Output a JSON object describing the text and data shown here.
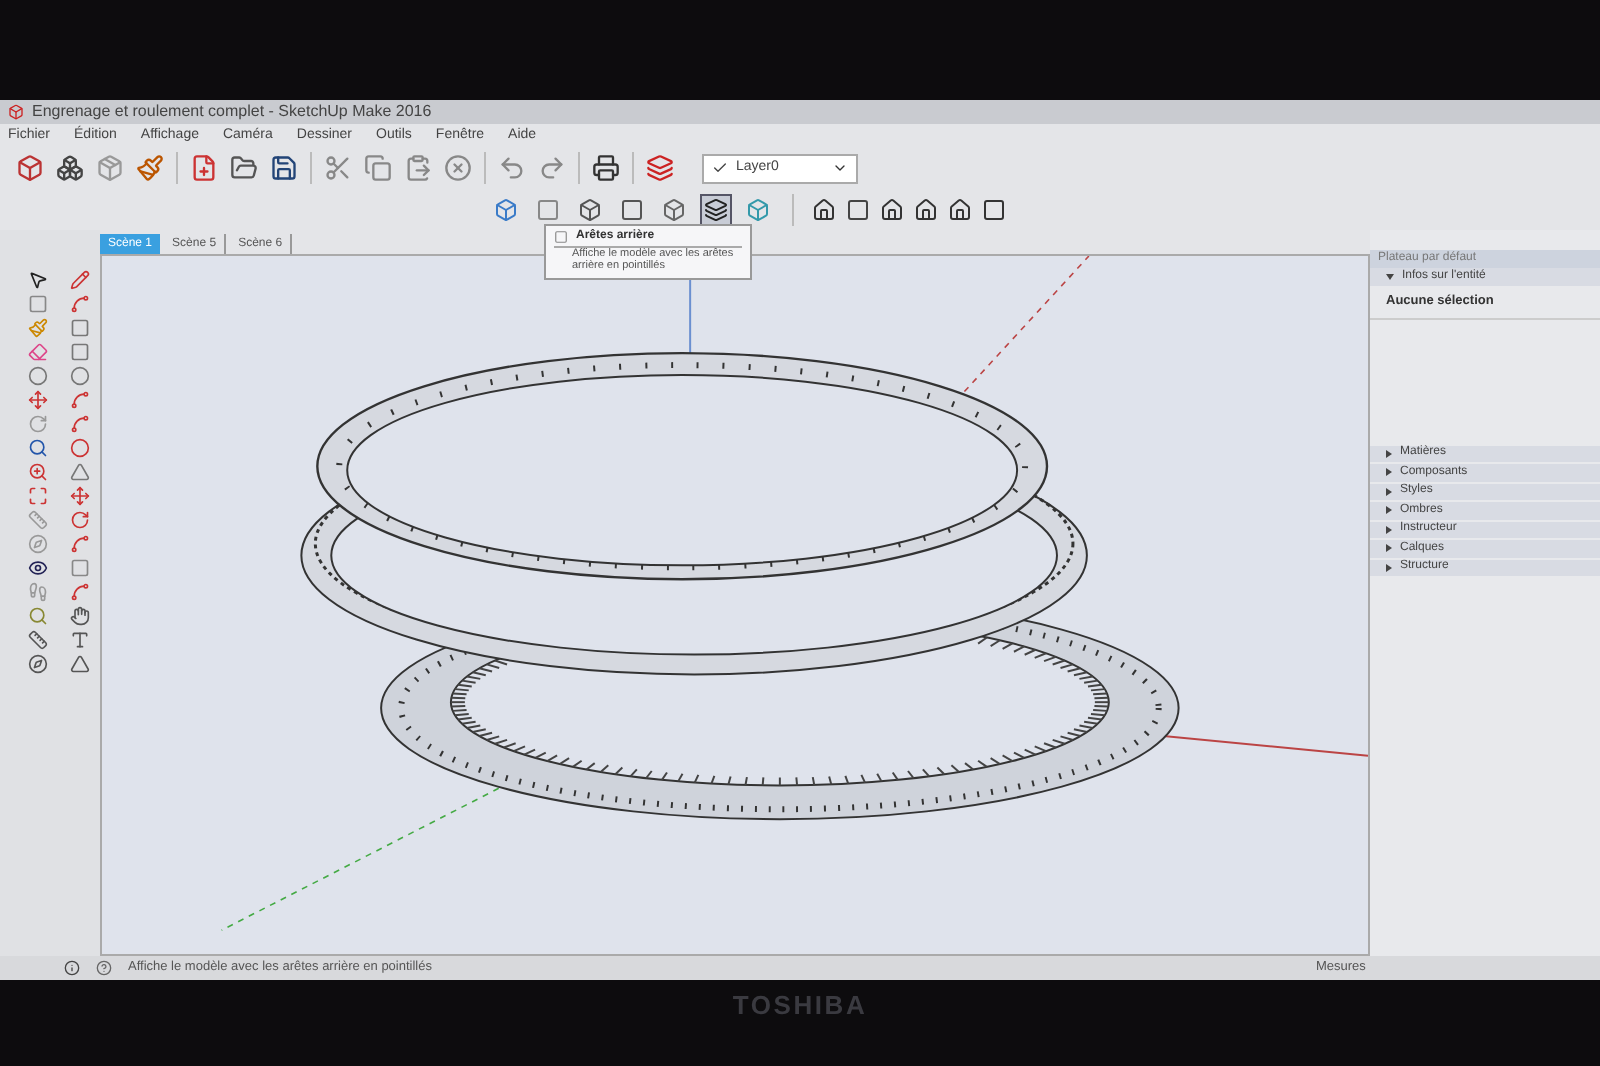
{
  "window": {
    "title": "Engrenage et roulement complet - SketchUp Make 2016"
  },
  "menu": [
    "Fichier",
    "Édition",
    "Affichage",
    "Caméra",
    "Dessiner",
    "Outils",
    "Fenêtre",
    "Aide"
  ],
  "layer_select": {
    "value": "Layer0"
  },
  "face_styles": [
    {
      "selected": false
    },
    {
      "selected": false
    },
    {
      "selected": false
    },
    {
      "selected": false
    },
    {
      "selected": false
    },
    {
      "selected": true
    },
    {
      "selected": false
    }
  ],
  "tooltip": {
    "title": "Arêtes arrière",
    "text": "Affiche le modèle avec les arêtes arrière en pointillés"
  },
  "scene_tabs": [
    {
      "label": "Scène 1",
      "selected": true
    },
    {
      "label": "Scène 5",
      "selected": false
    },
    {
      "label": "Scène 6",
      "selected": false
    }
  ],
  "tray": {
    "title": "Plateau par défaut",
    "entity_panel": {
      "label": "Infos sur l'entité",
      "expanded": true,
      "content": "Aucune sélection"
    },
    "panels": [
      {
        "label": "Matières",
        "expanded": false
      },
      {
        "label": "Composants",
        "expanded": false
      },
      {
        "label": "Styles",
        "expanded": false
      },
      {
        "label": "Ombres",
        "expanded": false
      },
      {
        "label": "Instructeur",
        "expanded": false
      },
      {
        "label": "Calques",
        "expanded": false
      },
      {
        "label": "Structure",
        "expanded": false
      }
    ]
  },
  "status_bar": {
    "text": "Affiche le modèle avec les arêtes arrière en pointillés",
    "measurements_label": "Mesures"
  },
  "monitor": {
    "brand": "TOSHIBA"
  }
}
